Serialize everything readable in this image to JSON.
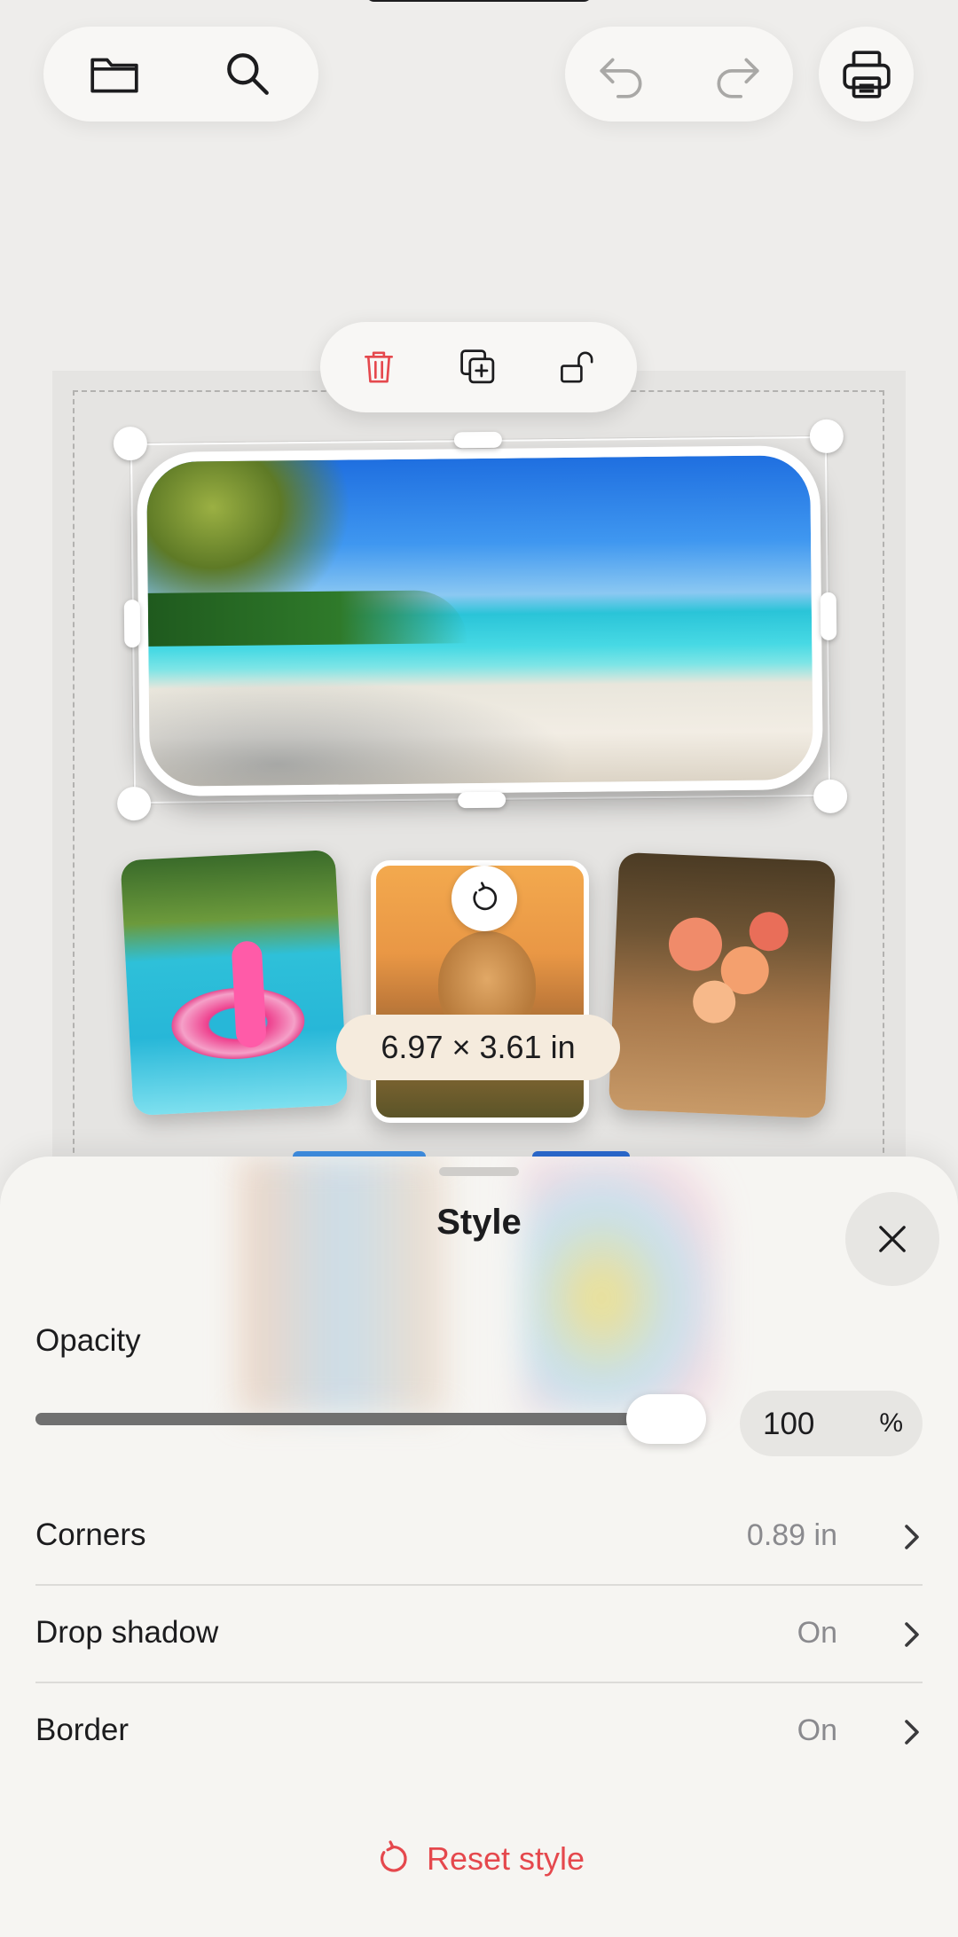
{
  "toolbar": {
    "left": [
      "folder-icon",
      "search-icon"
    ],
    "right": [
      "undo-icon",
      "redo-icon"
    ],
    "print": "print-icon"
  },
  "context_menu": [
    "trash-icon",
    "duplicate-icon",
    "unlock-icon"
  ],
  "canvas": {
    "dimensions_label": "6.97 × 3.61 in",
    "thumbnails": [
      "flamingo-pool",
      "golden-retriever",
      "flower-vase"
    ]
  },
  "sheet": {
    "title": "Style",
    "opacity": {
      "label": "Opacity",
      "value": "100",
      "unit": "%",
      "fraction": 1.0
    },
    "rows": [
      {
        "label": "Corners",
        "value": "0.89 in"
      },
      {
        "label": "Drop shadow",
        "value": "On"
      },
      {
        "label": "Border",
        "value": "On"
      }
    ],
    "reset_label": "Reset style"
  },
  "colors": {
    "accent_red": "#e5484d",
    "sheet_bg": "#f6f5f2",
    "page_bg": "#eeedeb"
  }
}
